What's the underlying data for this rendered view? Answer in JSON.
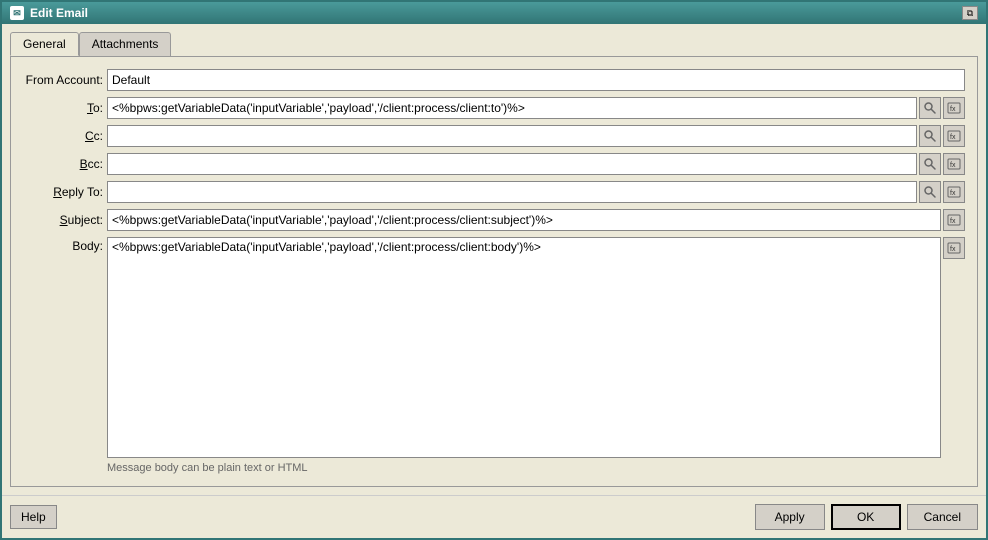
{
  "window": {
    "title": "Edit Email"
  },
  "tabs": [
    {
      "label": "General",
      "active": true
    },
    {
      "label": "Attachments",
      "active": false
    }
  ],
  "form": {
    "from_account_label": "From Account:",
    "from_account_value": "Default",
    "to_label": "To:",
    "to_value": "<%bpws:getVariableData('inputVariable','payload','/client:process/client:to')%>",
    "cc_label": "Cc:",
    "cc_value": "",
    "bcc_label": "Bcc:",
    "bcc_value": "",
    "reply_to_label": "Reply To:",
    "reply_to_value": "",
    "subject_label": "Subject:",
    "subject_value": "<%bpws:getVariableData('inputVariable','payload','/client:process/client:subject')%>",
    "body_label": "Body:",
    "body_value": "<%bpws:getVariableData('inputVariable','payload','/client:process/client:body')%>",
    "body_hint": "Message body can be plain text or HTML"
  },
  "footer": {
    "help_label": "Help",
    "apply_label": "Apply",
    "ok_label": "OK",
    "cancel_label": "Cancel"
  }
}
